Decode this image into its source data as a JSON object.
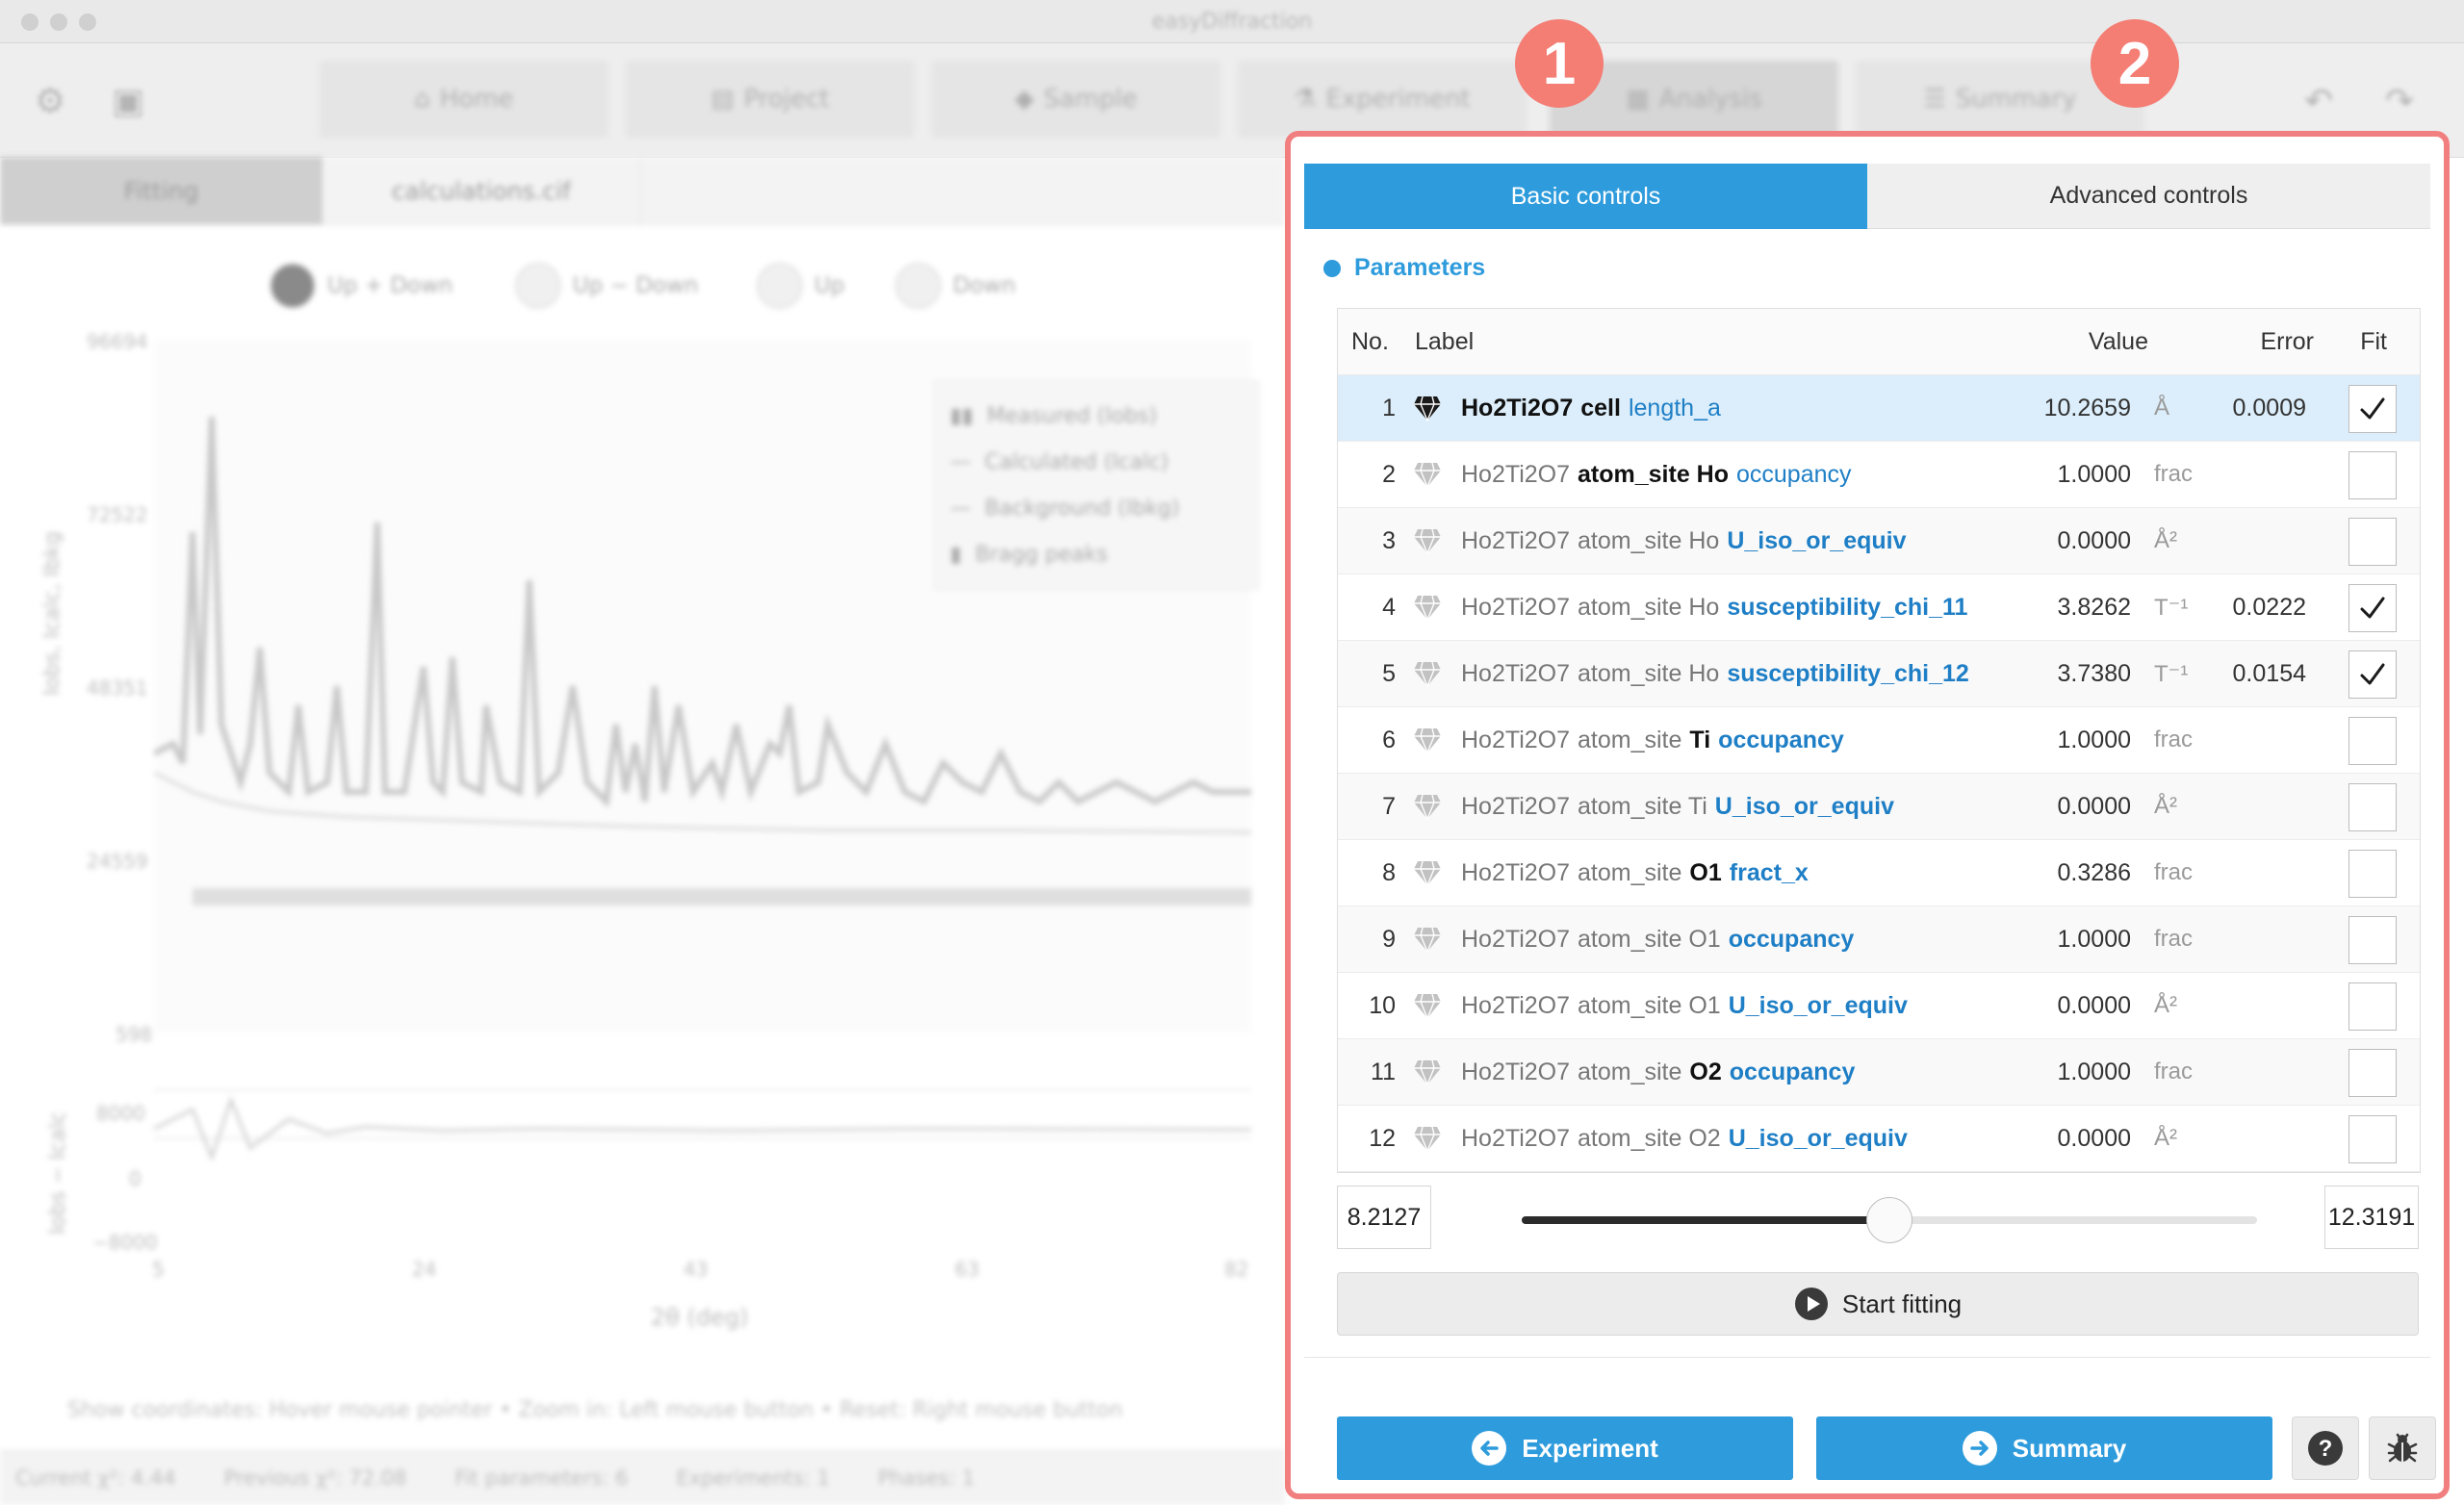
{
  "window": {
    "title": "easyDiffraction"
  },
  "toolbar": {
    "tabs": [
      {
        "label": "Home",
        "icon": "home-icon"
      },
      {
        "label": "Project",
        "icon": "project-icon"
      },
      {
        "label": "Sample",
        "icon": "gem-icon"
      },
      {
        "label": "Experiment",
        "icon": "flask-icon"
      },
      {
        "label": "Analysis",
        "icon": "analysis-icon",
        "active": true
      },
      {
        "label": "Summary",
        "icon": "summary-icon"
      }
    ],
    "badges": [
      "1",
      "2"
    ]
  },
  "left": {
    "subtabs": [
      "Fitting",
      "calculations.cif"
    ],
    "radio_options": [
      "Up + Down",
      "Up − Down",
      "Up",
      "Down"
    ],
    "chart": {
      "ylabel": "Iobs, Icalc, Ibkg",
      "ylabel_diff": "Iobs − Icalc",
      "xlabel": "2θ (deg)",
      "yticks": [
        "96694",
        "72522",
        "48351",
        "24559",
        "598"
      ],
      "diff_yticks": [
        "8000",
        "0",
        "−8000"
      ],
      "xticks": [
        "5",
        "24",
        "43",
        "63",
        "82"
      ],
      "legend": [
        "Measured (Iobs)",
        "Calculated (Icalc)",
        "Background (Ibkg)",
        "Bragg peaks"
      ]
    },
    "hint": "Show coordinates: Hover mouse pointer  •  Zoom in: Left mouse button  •  Reset: Right mouse button",
    "status": [
      "Current χ²: 4.44",
      "Previous χ²: 72.08",
      "Fit parameters: 6",
      "Experiments: 1",
      "Phases: 1"
    ]
  },
  "panel": {
    "tabs": {
      "basic": "Basic controls",
      "advanced": "Advanced controls"
    },
    "heading": "Parameters",
    "table": {
      "headers": {
        "no": "No.",
        "label": "Label",
        "value": "Value",
        "error": "Error",
        "fit": "Fit"
      },
      "rows": [
        {
          "no": "1",
          "prefix": "Ho2Ti2O7",
          "mid_bold": "cell",
          "mid_plain": "",
          "name": "length_a",
          "name_bold": false,
          "value": "10.2659",
          "unit": "Å",
          "error": "0.0009",
          "fit": true,
          "selected": true
        },
        {
          "no": "2",
          "prefix": "Ho2Ti2O7",
          "mid_bold": "atom_site Ho",
          "mid_plain": "",
          "name": "occupancy",
          "name_bold": false,
          "value": "1.0000",
          "unit": "frac",
          "error": "",
          "fit": false
        },
        {
          "no": "3",
          "prefix": "Ho2Ti2O7",
          "mid_bold": "",
          "mid_plain": "atom_site Ho",
          "name": "U_iso_or_equiv",
          "name_bold": true,
          "value": "0.0000",
          "unit": "Å²",
          "error": "",
          "fit": false
        },
        {
          "no": "4",
          "prefix": "Ho2Ti2O7",
          "mid_bold": "",
          "mid_plain": "atom_site Ho",
          "name": "susceptibility_chi_11",
          "name_bold": true,
          "value": "3.8262",
          "unit": "T⁻¹",
          "error": "0.0222",
          "fit": true
        },
        {
          "no": "5",
          "prefix": "Ho2Ti2O7",
          "mid_bold": "",
          "mid_plain": "atom_site Ho",
          "name": "susceptibility_chi_12",
          "name_bold": true,
          "value": "3.7380",
          "unit": "T⁻¹",
          "error": "0.0154",
          "fit": true
        },
        {
          "no": "6",
          "prefix": "Ho2Ti2O7",
          "mid_bold": "",
          "mid_plain": "atom_site",
          "mid_bold2": "Ti",
          "name": "occupancy",
          "name_bold": true,
          "value": "1.0000",
          "unit": "frac",
          "error": "",
          "fit": false
        },
        {
          "no": "7",
          "prefix": "Ho2Ti2O7",
          "mid_bold": "",
          "mid_plain": "atom_site Ti",
          "name": "U_iso_or_equiv",
          "name_bold": true,
          "value": "0.0000",
          "unit": "Å²",
          "error": "",
          "fit": false
        },
        {
          "no": "8",
          "prefix": "Ho2Ti2O7",
          "mid_bold": "",
          "mid_plain": "atom_site",
          "mid_bold2": "O1",
          "name": "fract_x",
          "name_bold": true,
          "value": "0.3286",
          "unit": "frac",
          "error": "",
          "fit": false
        },
        {
          "no": "9",
          "prefix": "Ho2Ti2O7",
          "mid_bold": "",
          "mid_plain": "atom_site O1",
          "name": "occupancy",
          "name_bold": true,
          "value": "1.0000",
          "unit": "frac",
          "error": "",
          "fit": false
        },
        {
          "no": "10",
          "prefix": "Ho2Ti2O7",
          "mid_bold": "",
          "mid_plain": "atom_site O1",
          "name": "U_iso_or_equiv",
          "name_bold": true,
          "value": "0.0000",
          "unit": "Å²",
          "error": "",
          "fit": false
        },
        {
          "no": "11",
          "prefix": "Ho2Ti2O7",
          "mid_bold": "",
          "mid_plain": "atom_site",
          "mid_bold2": "O2",
          "name": "occupancy",
          "name_bold": true,
          "value": "1.0000",
          "unit": "frac",
          "error": "",
          "fit": false
        },
        {
          "no": "12",
          "prefix": "Ho2Ti2O7",
          "mid_bold": "",
          "mid_plain": "atom_site O2",
          "name": "U_iso_or_equiv",
          "name_bold": true,
          "value": "0.0000",
          "unit": "Å²",
          "error": "",
          "fit": false
        }
      ]
    },
    "slider": {
      "min": "8.2127",
      "max": "12.3191",
      "value_fraction": 0.5
    },
    "fit_button": "Start fitting",
    "nav_prev": "Experiment",
    "nav_next": "Summary",
    "help_icon": "question-icon",
    "bug_icon": "bug-icon"
  },
  "colors": {
    "accent": "#2d9bdc",
    "highlight": "#f47d74",
    "selected_row": "#dceefb",
    "link": "#1f7fc6"
  }
}
